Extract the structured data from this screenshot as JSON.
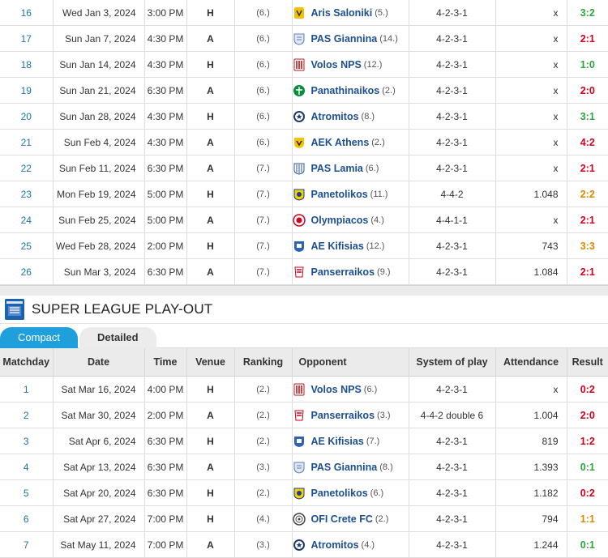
{
  "top_rows": [
    {
      "md": "16",
      "date": "Wed Jan 3, 2024",
      "time": "3:00 PM",
      "venue": "H",
      "ranking": "(6.)",
      "opponent": "Aris Saloniki",
      "opp_rank": "(5.)",
      "system": "4-2-3-1",
      "attendance": "x",
      "result": "3:2",
      "res_type": "win",
      "crest": "yellow"
    },
    {
      "md": "17",
      "date": "Sun Jan 7, 2024",
      "time": "4:30 PM",
      "venue": "A",
      "ranking": "(6.)",
      "opponent": "PAS Giannina",
      "opp_rank": "(14.)",
      "system": "4-2-3-1",
      "attendance": "x",
      "result": "2:1",
      "res_type": "loss",
      "crest": "blue-shield"
    },
    {
      "md": "18",
      "date": "Sun Jan 14, 2024",
      "time": "4:30 PM",
      "venue": "H",
      "ranking": "(6.)",
      "opponent": "Volos NPS",
      "opp_rank": "(12.)",
      "system": "4-2-3-1",
      "attendance": "x",
      "result": "1:0",
      "res_type": "win",
      "crest": "red-stripes"
    },
    {
      "md": "19",
      "date": "Sun Jan 21, 2024",
      "time": "6:30 PM",
      "venue": "A",
      "ranking": "(6.)",
      "opponent": "Panathinaikos",
      "opp_rank": "(2.)",
      "system": "4-2-3-1",
      "attendance": "x",
      "result": "2:0",
      "res_type": "loss",
      "crest": "green"
    },
    {
      "md": "20",
      "date": "Sun Jan 28, 2024",
      "time": "4:30 PM",
      "venue": "H",
      "ranking": "(6.)",
      "opponent": "Atromitos",
      "opp_rank": "(8.)",
      "system": "4-2-3-1",
      "attendance": "x",
      "result": "3:1",
      "res_type": "win",
      "crest": "navy-star"
    },
    {
      "md": "21",
      "date": "Sun Feb 4, 2024",
      "time": "4:30 PM",
      "venue": "A",
      "ranking": "(6.)",
      "opponent": "AEK Athens",
      "opp_rank": "(2.)",
      "system": "4-2-3-1",
      "attendance": "x",
      "result": "4:2",
      "res_type": "loss",
      "crest": "yellow-black"
    },
    {
      "md": "22",
      "date": "Sun Feb 11, 2024",
      "time": "6:30 PM",
      "venue": "A",
      "ranking": "(7.)",
      "opponent": "PAS Lamia",
      "opp_rank": "(6.)",
      "system": "4-2-3-1",
      "attendance": "x",
      "result": "2:1",
      "res_type": "loss",
      "crest": "blue-white"
    },
    {
      "md": "23",
      "date": "Mon Feb 19, 2024",
      "time": "5:00 PM",
      "venue": "H",
      "ranking": "(7.)",
      "opponent": "Panetolikos",
      "opp_rank": "(11.)",
      "system": "4-4-2",
      "attendance": "1.048",
      "result": "2:2",
      "res_type": "draw",
      "crest": "yellow-blue"
    },
    {
      "md": "24",
      "date": "Sun Feb 25, 2024",
      "time": "5:00 PM",
      "venue": "A",
      "ranking": "(7.)",
      "opponent": "Olympiacos",
      "opp_rank": "(4.)",
      "system": "4-4-1-1",
      "attendance": "x",
      "result": "2:1",
      "res_type": "loss",
      "crest": "red-circle"
    },
    {
      "md": "25",
      "date": "Wed Feb 28, 2024",
      "time": "2:00 PM",
      "venue": "H",
      "ranking": "(7.)",
      "opponent": "AE Kifisias",
      "opp_rank": "(12.)",
      "system": "4-2-3-1",
      "attendance": "743",
      "result": "3:3",
      "res_type": "draw",
      "crest": "blue-shield2"
    },
    {
      "md": "26",
      "date": "Sun Mar 3, 2024",
      "time": "6:30 PM",
      "venue": "A",
      "ranking": "(7.)",
      "opponent": "Panserraikos",
      "opp_rank": "(9.)",
      "system": "4-2-3-1",
      "attendance": "1.084",
      "result": "2:1",
      "res_type": "loss",
      "crest": "red-white"
    }
  ],
  "section": {
    "title": "SUPER LEAGUE PLAY-OUT"
  },
  "tabs": {
    "compact": "Compact",
    "detailed": "Detailed"
  },
  "headers": {
    "matchday": "Matchday",
    "date": "Date",
    "time": "Time",
    "venue": "Venue",
    "ranking": "Ranking",
    "opponent": "Opponent",
    "system": "System of play",
    "attendance": "Attendance",
    "result": "Result"
  },
  "bottom_rows": [
    {
      "md": "1",
      "date": "Sat Mar 16, 2024",
      "time": "4:00 PM",
      "venue": "H",
      "ranking": "(2.)",
      "opponent": "Volos NPS",
      "opp_rank": "(6.)",
      "system": "4-2-3-1",
      "attendance": "x",
      "result": "0:2",
      "res_type": "loss",
      "crest": "red-stripes"
    },
    {
      "md": "2",
      "date": "Sat Mar 30, 2024",
      "time": "2:00 PM",
      "venue": "A",
      "ranking": "(2.)",
      "opponent": "Panserraikos",
      "opp_rank": "(3.)",
      "system": "4-4-2 double 6",
      "attendance": "1.004",
      "result": "2:0",
      "res_type": "loss",
      "crest": "red-white"
    },
    {
      "md": "3",
      "date": "Sat Apr 6, 2024",
      "time": "6:30 PM",
      "venue": "H",
      "ranking": "(2.)",
      "opponent": "AE Kifisias",
      "opp_rank": "(7.)",
      "system": "4-2-3-1",
      "attendance": "819",
      "result": "1:2",
      "res_type": "loss",
      "crest": "blue-shield2"
    },
    {
      "md": "4",
      "date": "Sat Apr 13, 2024",
      "time": "6:30 PM",
      "venue": "A",
      "ranking": "(3.)",
      "opponent": "PAS Giannina",
      "opp_rank": "(8.)",
      "system": "4-2-3-1",
      "attendance": "1.393",
      "result": "0:1",
      "res_type": "win",
      "crest": "blue-shield"
    },
    {
      "md": "5",
      "date": "Sat Apr 20, 2024",
      "time": "6:30 PM",
      "venue": "H",
      "ranking": "(2.)",
      "opponent": "Panetolikos",
      "opp_rank": "(6.)",
      "system": "4-2-3-1",
      "attendance": "1.182",
      "result": "0:2",
      "res_type": "loss",
      "crest": "yellow-blue"
    },
    {
      "md": "6",
      "date": "Sat Apr 27, 2024",
      "time": "7:00 PM",
      "venue": "H",
      "ranking": "(4.)",
      "opponent": "OFI Crete FC",
      "opp_rank": "(2.)",
      "system": "4-2-3-1",
      "attendance": "794",
      "result": "1:1",
      "res_type": "draw",
      "crest": "grey-circle"
    },
    {
      "md": "7",
      "date": "Sat May 11, 2024",
      "time": "7:00 PM",
      "venue": "A",
      "ranking": "(3.)",
      "opponent": "Atromitos",
      "opp_rank": "(4.)",
      "system": "4-2-3-1",
      "attendance": "1.244",
      "result": "0:1",
      "res_type": "win",
      "crest": "navy-star"
    }
  ],
  "colors": {
    "link": "#1d75a3",
    "opponent": "#1d4f91",
    "win": "#2fa43c",
    "loss": "#d0021b",
    "draw": "#d88a00",
    "tab_active": "#1fa0dc"
  }
}
